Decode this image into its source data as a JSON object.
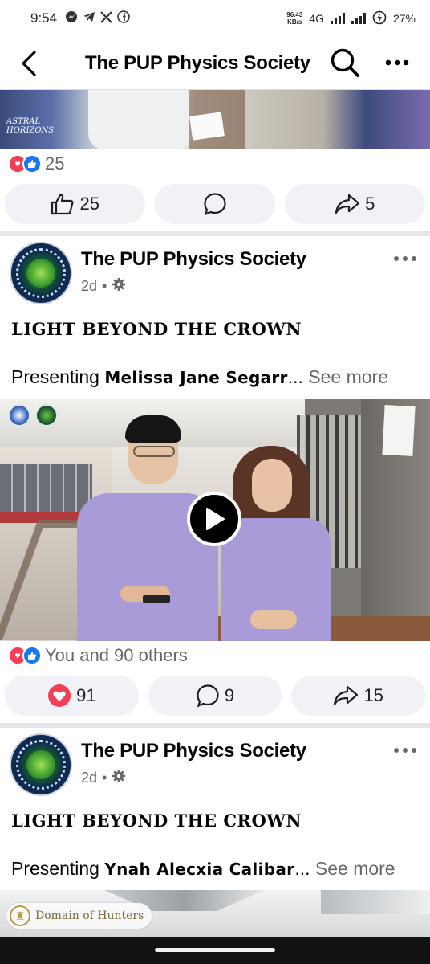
{
  "status_bar": {
    "time": "9:54",
    "net_speed_value": "96.43",
    "net_speed_unit": "KB/s",
    "network": "4G",
    "battery": "27%"
  },
  "header": {
    "title": "The PUP Physics Society"
  },
  "posts": [
    {
      "image_logo_text": "ASTRAL HORIZONS",
      "reaction_count": "25",
      "actions": {
        "like_count": "25",
        "comment_count": "",
        "share_count": "5"
      }
    },
    {
      "page_name": "The PUP Physics Society",
      "time": "2d",
      "title": "LIGHT BEYOND THE CROWN",
      "text_prefix": "Presenting ",
      "text_bold": "Melissa Jane Segarr",
      "ellipsis": "...",
      "see_more": " See more",
      "reaction_summary": "You and 90 others",
      "actions": {
        "love_count": "91",
        "comment_count": "9",
        "share_count": "15"
      }
    },
    {
      "page_name": "The PUP Physics Society",
      "time": "2d",
      "title": "LIGHT BEYOND THE CROWN",
      "text_prefix": "Presenting ",
      "text_bold": "Ynah Alecxia Calibar",
      "ellipsis": "...",
      "see_more": " See more",
      "image_badge": "Domain of Hunters"
    }
  ],
  "colors": {
    "love": "#f33e58",
    "like": "#1877f2",
    "secondary_text": "#65676b",
    "button_bg": "#f0f2f5"
  }
}
